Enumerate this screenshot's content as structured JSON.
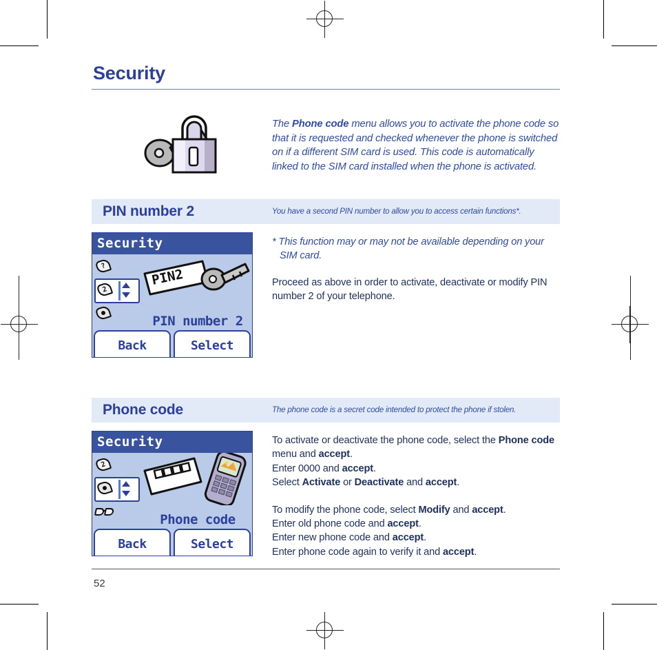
{
  "document": {
    "page_title": "Security",
    "page_number": "52"
  },
  "intro": {
    "art_icon": "padlock-and-key-icon",
    "text_prefix": "The ",
    "bold_1": "Phone code",
    "text_rest": " menu allows you to activate the phone code so that it is requested and checked whenever the phone is switched on if a different SIM card is used. This code is automatically linked to the SIM card installed when the phone is activated."
  },
  "sections": [
    {
      "title": "PIN number 2",
      "note": "You have a second PIN number to allow you to access certain functions*.",
      "phone": {
        "titlebar": "Security",
        "menu_label": "PIN number 2",
        "art_icon": "pin2-tag-and-key-icon",
        "softkey_left": "Back",
        "softkey_right": "Select",
        "rail_icons": [
          "key-question-icon",
          "key-2-icon",
          "key-dot-icon"
        ]
      },
      "footnote_line1": "* This function may or may not be available depending on your",
      "footnote_line2": "SIM card.",
      "paragraph": "Proceed as above in order to activate, deactivate or modify PIN number 2 of your telephone."
    },
    {
      "title": "Phone code",
      "note": "The phone code is a secret code intended to protect the phone if stolen.",
      "phone": {
        "titlebar": "Security",
        "menu_label": "Phone code",
        "art_icon": "code-keypad-and-handset-icon",
        "softkey_left": "Back",
        "softkey_right": "Select",
        "rail_icons": [
          "key-2-icon",
          "key-dot-icon",
          "glasses-icon"
        ]
      },
      "instructions": {
        "p1_a": "To activate or deactivate the phone code, select the ",
        "p1_b1": "Phone code",
        "p1_c": " menu and ",
        "p1_b2": "accept",
        "p1_d": ".",
        "p2_a": "Enter 0000 and ",
        "p2_b": "accept",
        "p2_c": ".",
        "p3_a": "Select ",
        "p3_b1": "Activate",
        "p3_c": " or ",
        "p3_b2": "Deactivate",
        "p3_d": " and ",
        "p3_b3": "accept",
        "p3_e": ".",
        "p4_a": "To modify the phone code, select ",
        "p4_b1": "Modify",
        "p4_c": " and ",
        "p4_b2": "accept",
        "p4_d": ".",
        "p5_a": "Enter old phone code and ",
        "p5_b": "accept",
        "p5_c": ".",
        "p6_a": "Enter new phone code and ",
        "p6_b": "accept",
        "p6_c": ".",
        "p7_a": "Enter phone code again to verify it and ",
        "p7_b": "accept",
        "p7_c": "."
      }
    }
  ],
  "colors": {
    "heading_blue": "#2b3f9c",
    "band_bg": "#e3eaf7",
    "body_blue": "#22397f",
    "phone_bg": "#b9cbe8",
    "phone_titlebar": "#39539f"
  }
}
